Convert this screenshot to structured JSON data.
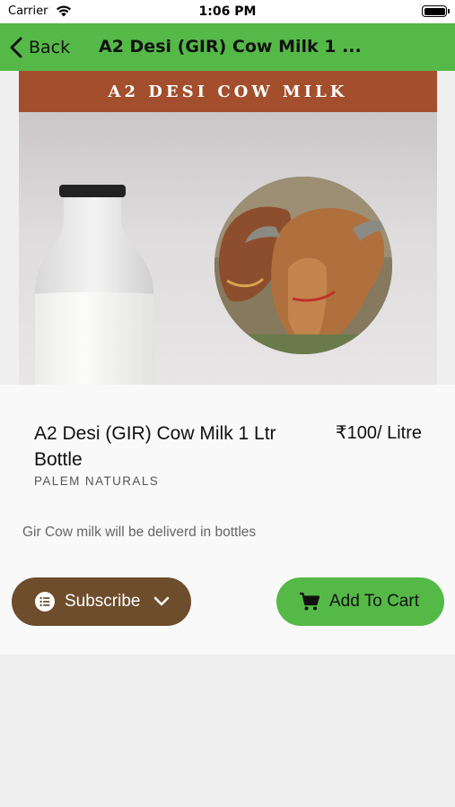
{
  "status_bar": {
    "carrier": "Carrier",
    "time": "1:06 PM"
  },
  "nav": {
    "back_label": "Back",
    "title": "A2 Desi (GIR) Cow Milk 1 ..."
  },
  "hero": {
    "banner_text": "A2 DESI COW MILK"
  },
  "product": {
    "name": "A2 Desi (GIR) Cow Milk 1 Ltr Bottle",
    "price": "₹100/ Litre",
    "brand": "PALEM NATURALS",
    "description": "Gir Cow milk will be deliverd in bottles"
  },
  "actions": {
    "subscribe_label": "Subscribe",
    "add_to_cart_label": "Add To Cart"
  },
  "colors": {
    "nav_green": "#55b948",
    "banner_brown": "#a34e2c",
    "subscribe_brown": "#6e4d2c"
  }
}
